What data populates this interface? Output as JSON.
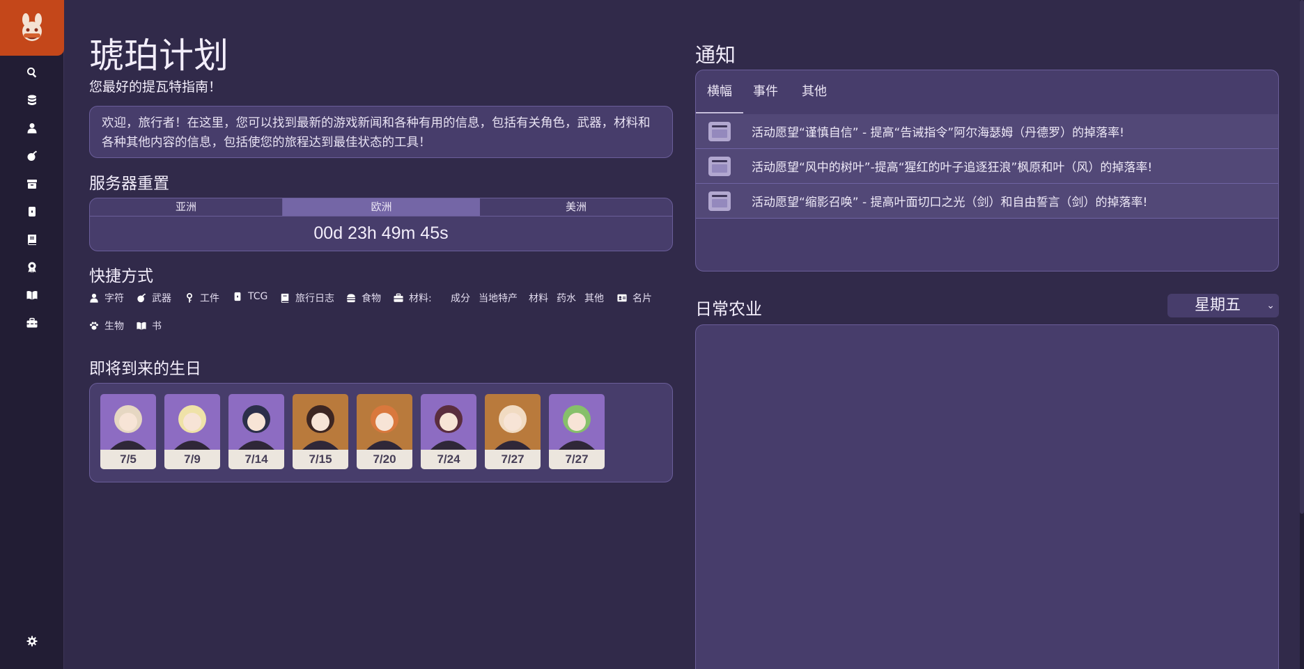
{
  "sidebar": {
    "items": [
      {
        "icon": "search-icon"
      },
      {
        "icon": "database-icon"
      },
      {
        "icon": "user-icon"
      },
      {
        "icon": "bomb-icon"
      },
      {
        "icon": "archive-icon"
      },
      {
        "icon": "card-icon"
      },
      {
        "icon": "book-icon"
      },
      {
        "icon": "award-icon"
      },
      {
        "icon": "open-book-icon"
      },
      {
        "icon": "toolbox-icon"
      }
    ],
    "settings_icon": "gear-icon"
  },
  "header": {
    "title": "琥珀计划",
    "subtitle": "您最好的提瓦特指南！"
  },
  "welcome": "欢迎，旅行者！在这里，您可以找到最新的游戏新闻和各种有用的信息，包括有关角色，武器，材料和各种其他内容的信息，包括使您的旅程达到最佳状态的工具！",
  "server_reset": {
    "title": "服务器重置",
    "regions": [
      "亚洲",
      "欧洲",
      "美洲"
    ],
    "active_region": "欧洲",
    "countdown": "00d 23h 49m 45s"
  },
  "shortcuts": {
    "title": "快捷方式",
    "items": [
      {
        "label": "字符",
        "icon": "user-icon"
      },
      {
        "label": "武器",
        "icon": "bomb-icon"
      },
      {
        "label": "工件",
        "icon": "key-icon"
      },
      {
        "label": "TCG",
        "icon": "card-icon"
      },
      {
        "label": "旅行日志",
        "icon": "book-icon"
      },
      {
        "label": "食物",
        "icon": "burger-icon"
      },
      {
        "label": "材料:",
        "icon": "briefcase-icon"
      },
      {
        "label": "成分"
      },
      {
        "label": "当地特产"
      },
      {
        "label": "材料"
      },
      {
        "label": "药水"
      },
      {
        "label": "其他"
      },
      {
        "label": "名片",
        "icon": "id-card-icon"
      },
      {
        "label": "生物",
        "icon": "paw-icon"
      },
      {
        "label": "书",
        "icon": "open-book-icon"
      }
    ]
  },
  "birthdays": {
    "title": "即将到来的生日",
    "cards": [
      {
        "date": "7/5",
        "bg": "#8d6cc2",
        "hair": "#e6d7c2"
      },
      {
        "date": "7/9",
        "bg": "#8d6cc2",
        "hair": "#efe2a8"
      },
      {
        "date": "7/14",
        "bg": "#8d6cc2",
        "hair": "#2c2f4a"
      },
      {
        "date": "7/15",
        "bg": "#b97a3c",
        "hair": "#3d2622"
      },
      {
        "date": "7/20",
        "bg": "#b97a3c",
        "hair": "#d9783d"
      },
      {
        "date": "7/24",
        "bg": "#8d6cc2",
        "hair": "#5a2d3e"
      },
      {
        "date": "7/27",
        "bg": "#b97a3c",
        "hair": "#f1dbc2"
      },
      {
        "date": "7/27",
        "bg": "#8d6cc2",
        "hair": "#86c06a"
      }
    ]
  },
  "notices": {
    "title": "通知",
    "tabs": [
      "横幅",
      "事件",
      "其他"
    ],
    "active_tab": "横幅",
    "items": [
      "活动愿望“谨慎自信” - 提高“告诫指令”阿尔海瑟姆（丹德罗）的掉落率!",
      "活动愿望“风中的树叶”-提高“猩红的叶子追逐狂浪”枫原和叶（风）的掉落率!",
      "活动愿望“缩影召唤” - 提高叶面切口之光（剑）和自由誓言（剑）的掉落率!"
    ]
  },
  "daily_farming": {
    "title": "日常农业",
    "selected_day": "星期五"
  },
  "colors": {
    "background": "#312a4a",
    "sidebar": "#221d34",
    "panel": "#473d6b",
    "accent": "#c4471a"
  }
}
